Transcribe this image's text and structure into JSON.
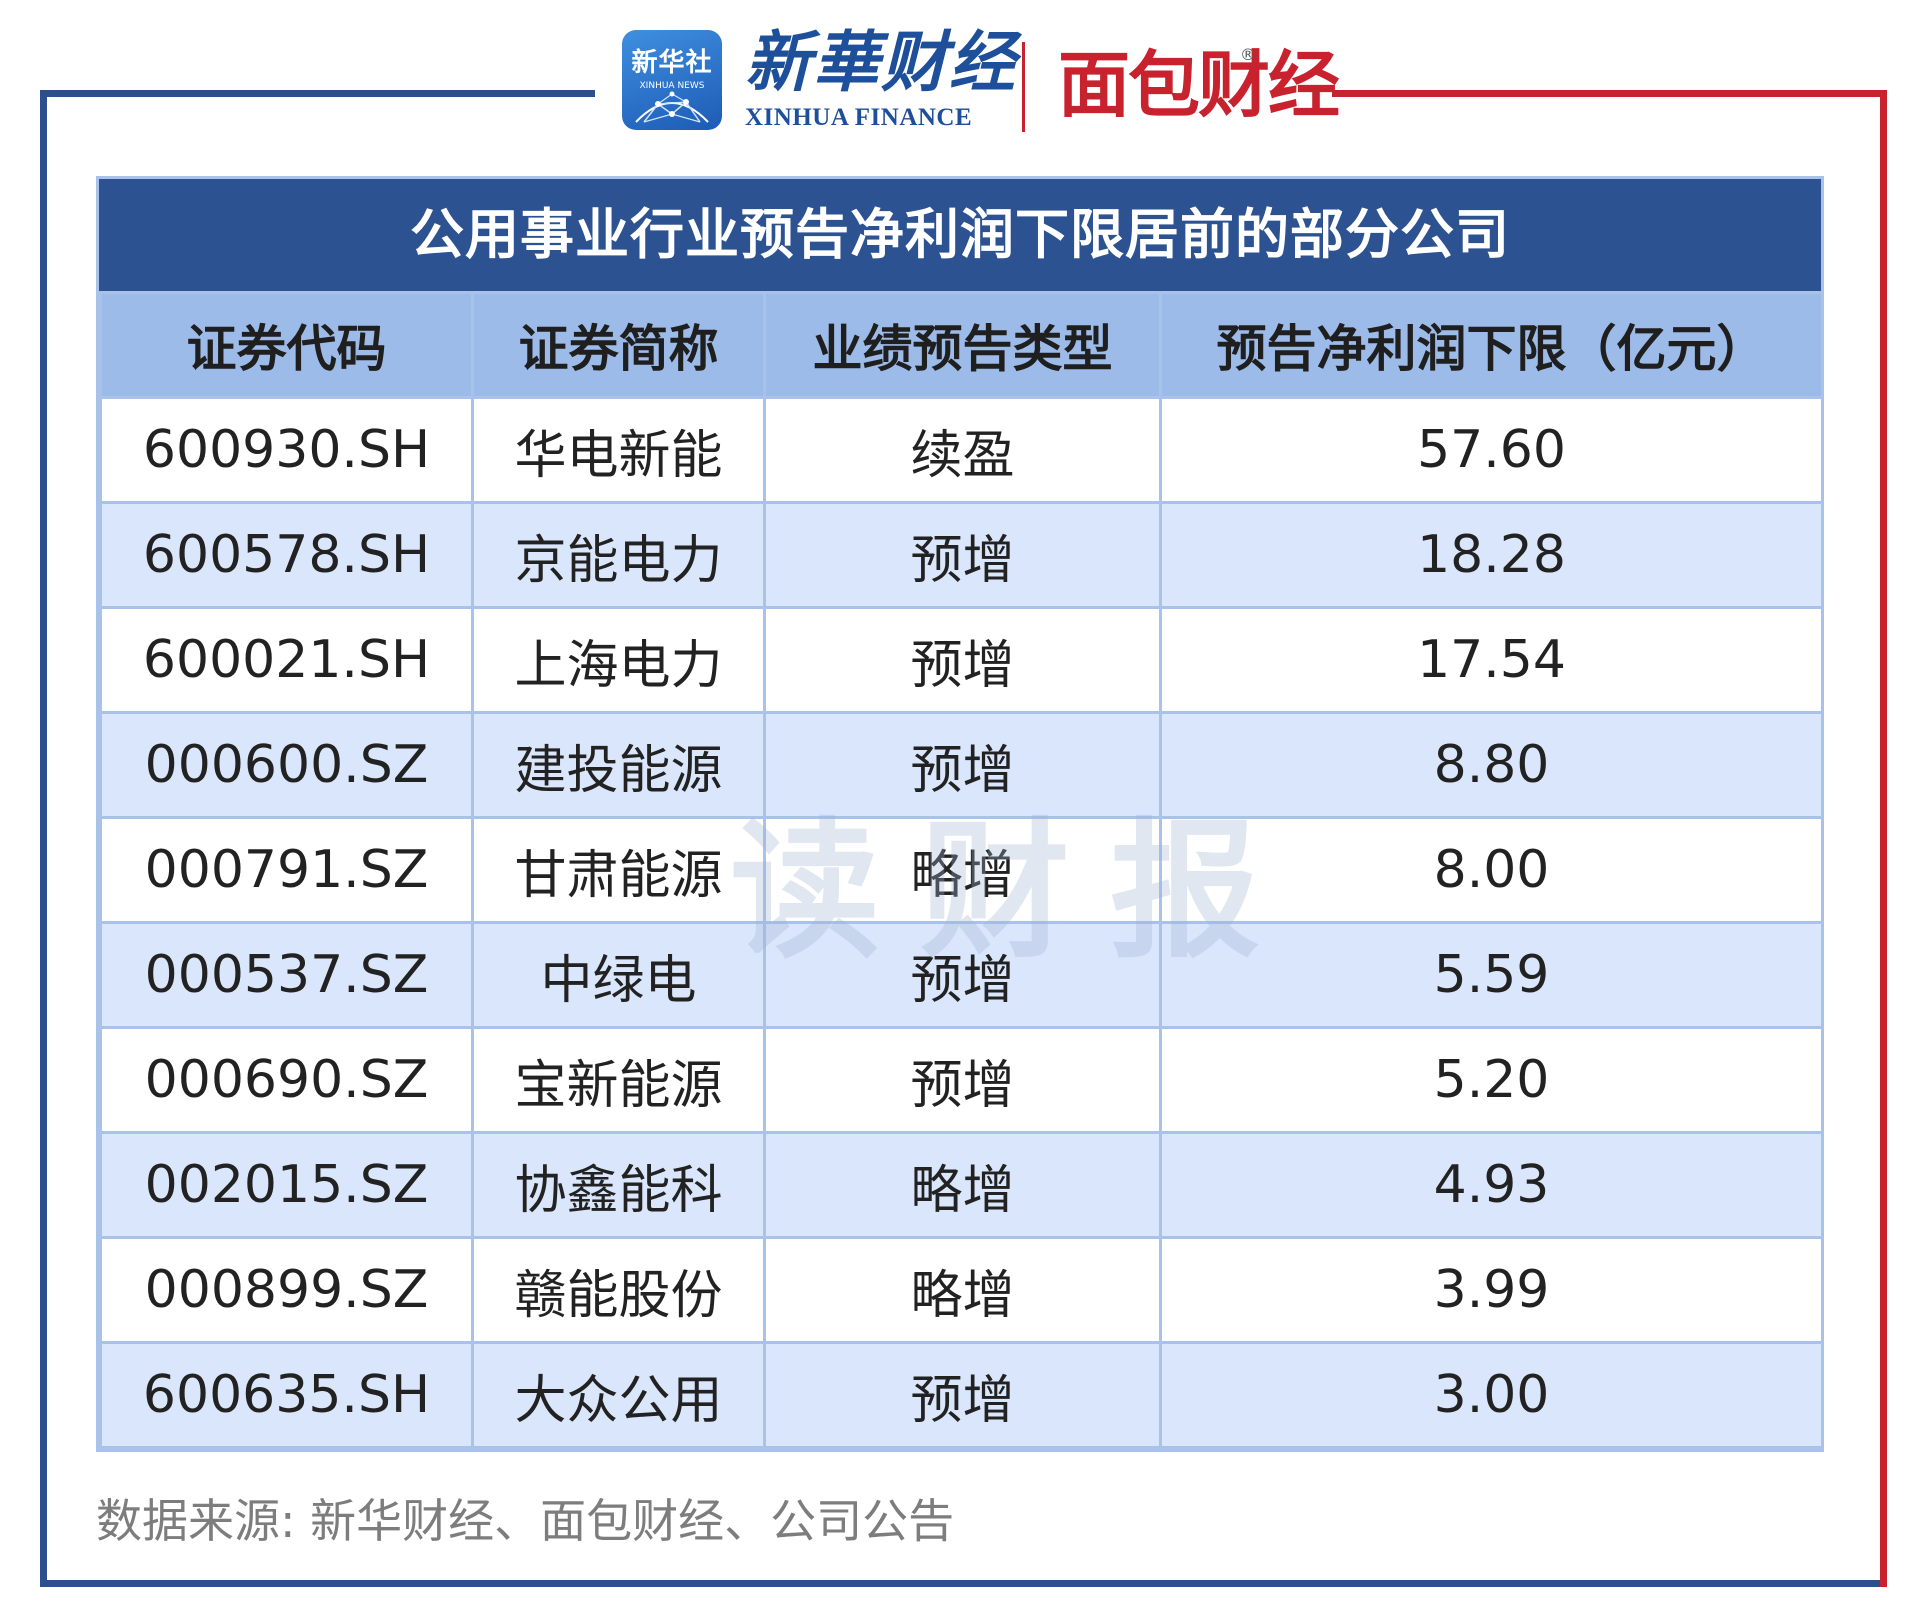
{
  "header": {
    "logo_xinhuashe_cn": "新华社",
    "logo_xinhuashe_en": "XINHUA NEWS",
    "logo_xinhuacaijing_cn": "新華财经",
    "logo_xinhuacaijing_en": "XINHUA FINANCE",
    "logo_mianbaocaijing": "面包财经",
    "logo_mianbaocaijing_reg": "®"
  },
  "table": {
    "title": "公用事业行业预告净利润下限居前的部分公司",
    "columns": [
      "证券代码",
      "证券简称",
      "业绩预告类型",
      "预告净利润下限（亿元）"
    ],
    "rows": [
      {
        "code": "600930.SH",
        "name": "华电新能",
        "type": "续盈",
        "value": "57.60"
      },
      {
        "code": "600578.SH",
        "name": "京能电力",
        "type": "预增",
        "value": "18.28"
      },
      {
        "code": "600021.SH",
        "name": "上海电力",
        "type": "预增",
        "value": "17.54"
      },
      {
        "code": "000600.SZ",
        "name": "建投能源",
        "type": "预增",
        "value": "8.80"
      },
      {
        "code": "000791.SZ",
        "name": "甘肃能源",
        "type": "略增",
        "value": "8.00"
      },
      {
        "code": "000537.SZ",
        "name": "中绿电",
        "type": "预增",
        "value": "5.59"
      },
      {
        "code": "000690.SZ",
        "name": "宝新能源",
        "type": "预增",
        "value": "5.20"
      },
      {
        "code": "002015.SZ",
        "name": "协鑫能科",
        "type": "略增",
        "value": "4.93"
      },
      {
        "code": "000899.SZ",
        "name": "赣能股份",
        "type": "略增",
        "value": "3.99"
      },
      {
        "code": "600635.SH",
        "name": "大众公用",
        "type": "预增",
        "value": "3.00"
      }
    ]
  },
  "watermark": "读财报",
  "source": "数据来源: 新华财经、面包财经、公司公告",
  "colors": {
    "brand_blue": "#2d5291",
    "header_row": "#9dbbe8",
    "stripe_row": "#dae6fb",
    "brand_red": "#c8222f"
  }
}
